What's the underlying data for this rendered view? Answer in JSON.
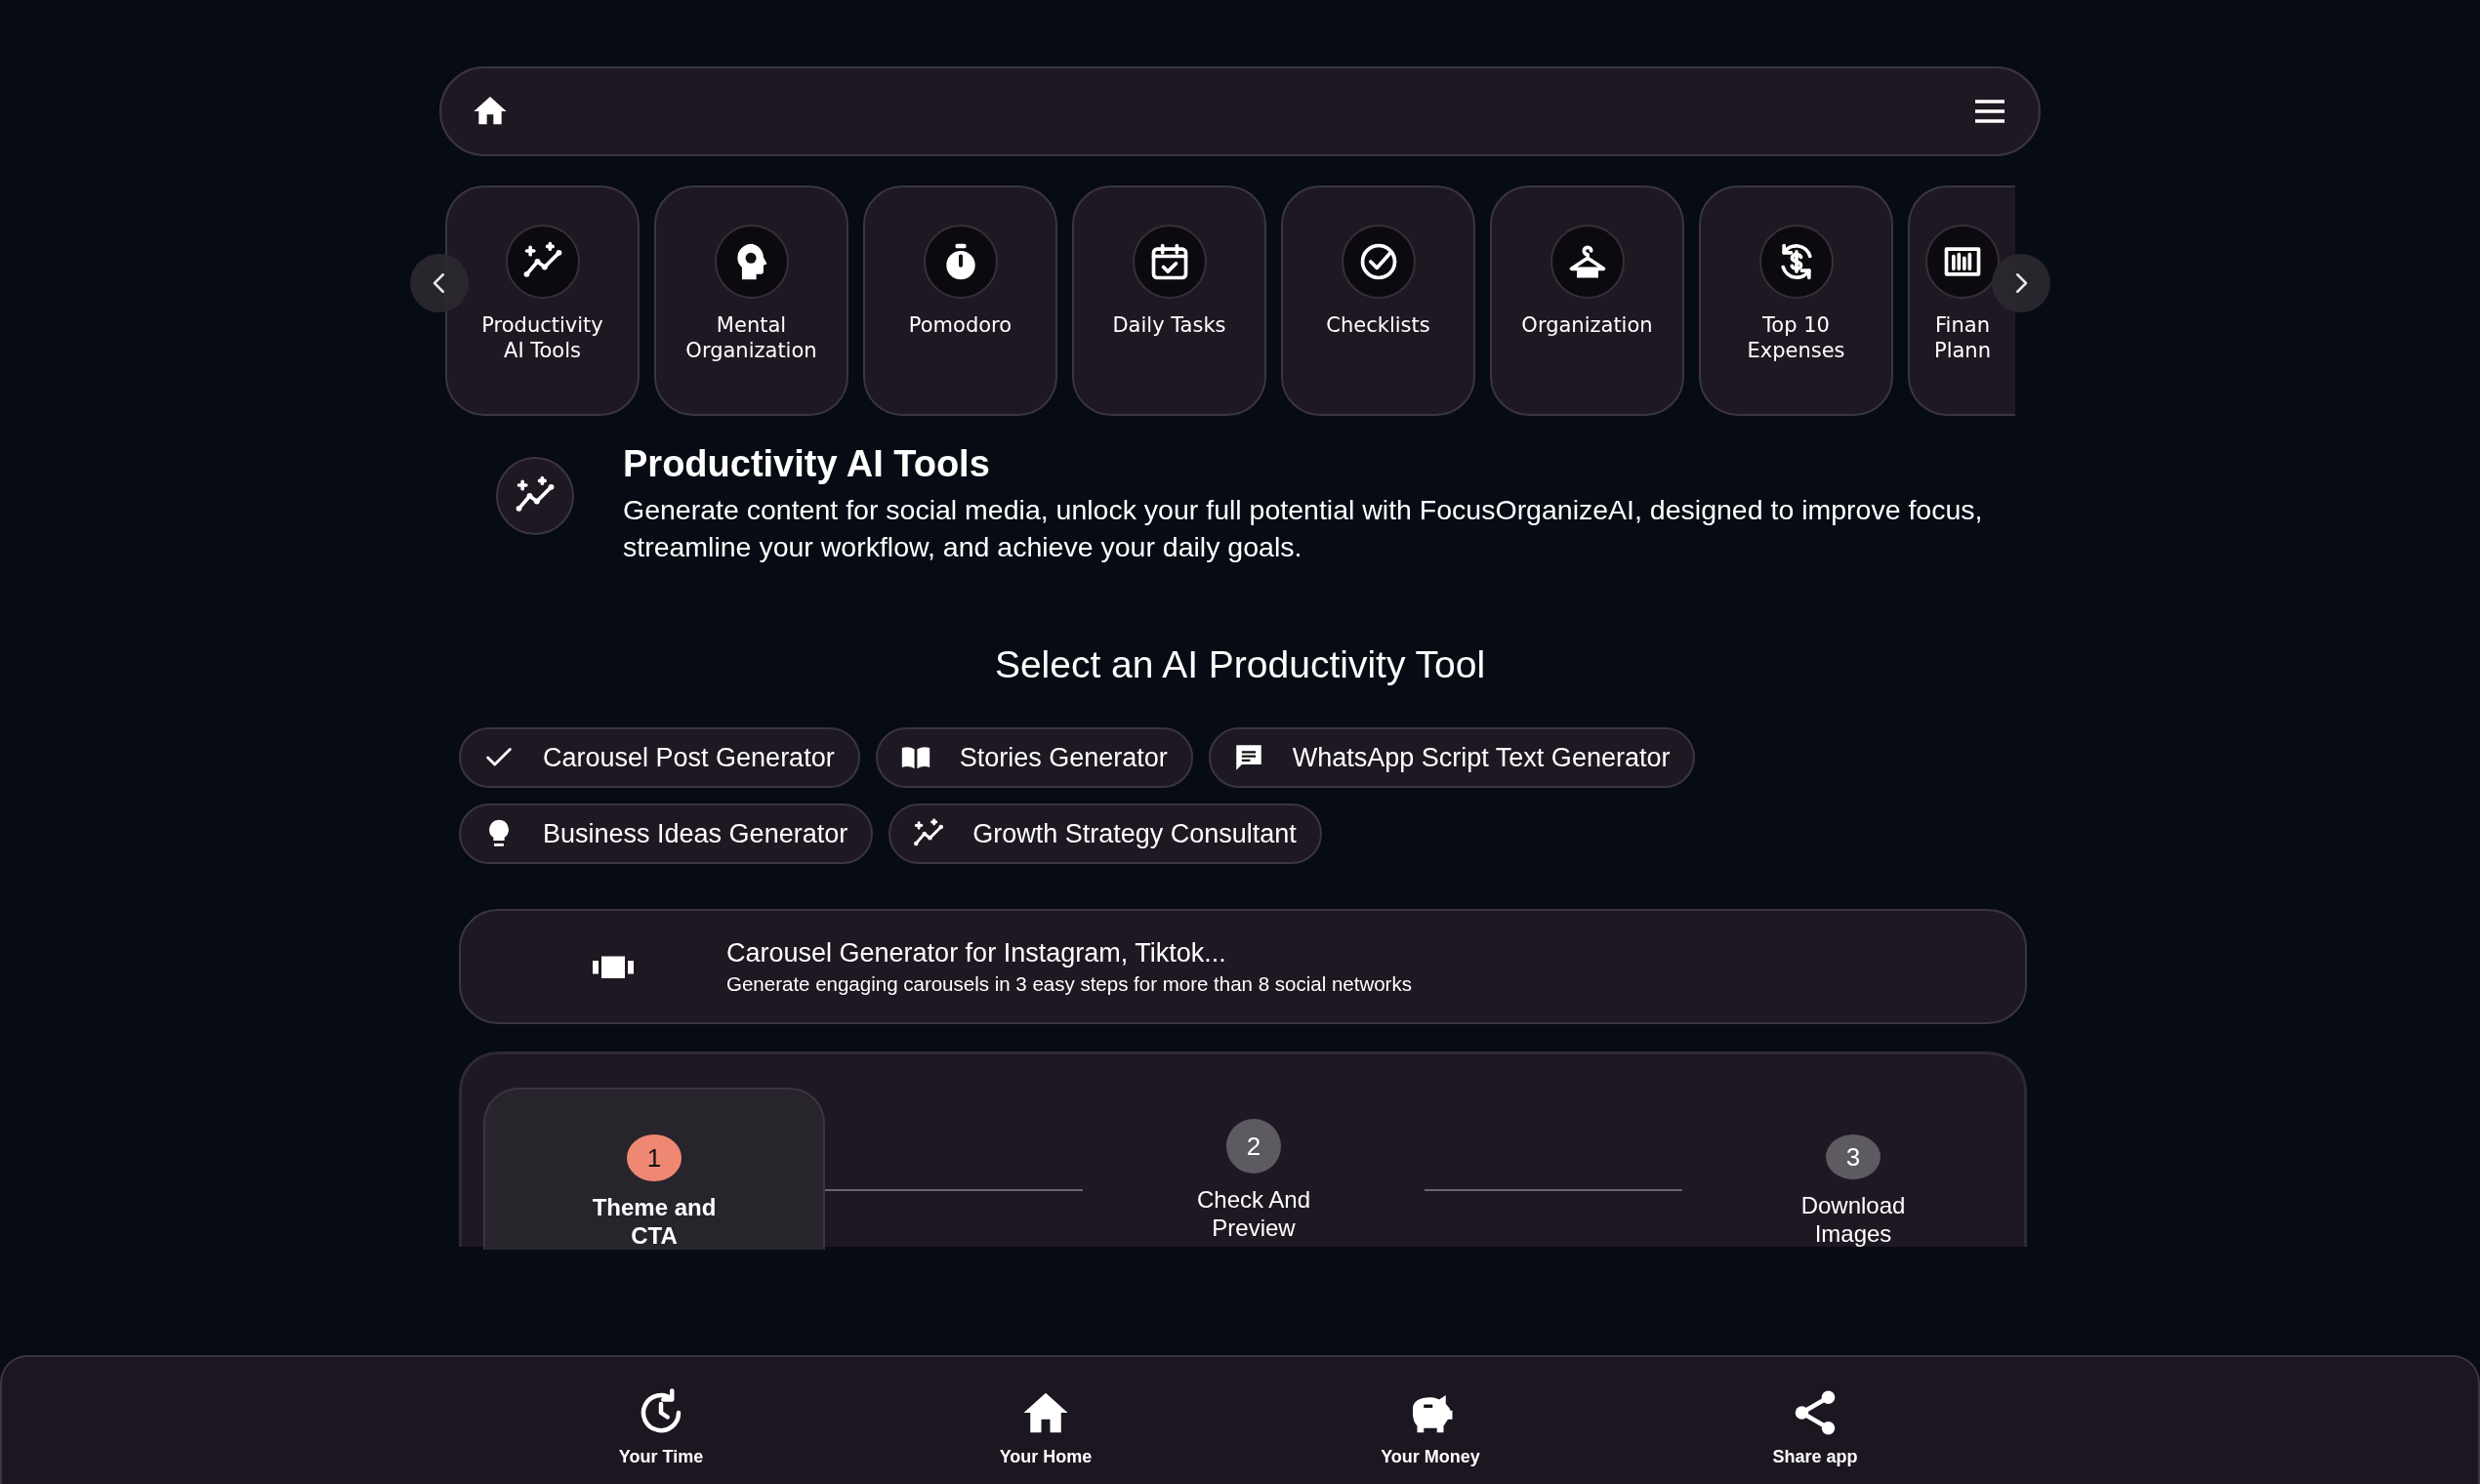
{
  "categories": [
    {
      "lines": [
        "Productivity",
        "AI Tools"
      ]
    },
    {
      "lines": [
        "Mental",
        "Organization"
      ]
    },
    {
      "lines": [
        "Pomodoro"
      ]
    },
    {
      "lines": [
        "Daily Tasks"
      ]
    },
    {
      "lines": [
        "Checklists"
      ]
    },
    {
      "lines": [
        "Organization"
      ]
    },
    {
      "lines": [
        "Top 10",
        "Expenses"
      ]
    },
    {
      "lines": [
        "Finan",
        "Plann"
      ]
    }
  ],
  "intro": {
    "title": "Productivity AI Tools",
    "text": "Generate content for social media, unlock your full potential with FocusOrganizeAI, designed to improve focus, streamline your workflow, and achieve your daily goals."
  },
  "tools_heading": "Select an AI Productivity Tool",
  "tools": [
    [
      "Carousel Post Generator",
      "Stories Generator",
      "WhatsApp Script Text Generator"
    ],
    [
      "Business Ideas Generator",
      "Growth Strategy Consultant"
    ]
  ],
  "carousel": {
    "title": "Carousel Generator for Instagram, Tiktok...",
    "subtitle": "Generate engaging carousels in 3 easy steps for more than 8 social networks"
  },
  "steps": [
    {
      "number": "1",
      "label": "Theme and CTA",
      "selected": true
    },
    {
      "number": "2",
      "label": "Check And Preview",
      "selected": false
    },
    {
      "number": "3",
      "label": "Download Images",
      "selected": false
    }
  ],
  "bottom_nav": [
    {
      "label": "Your Time"
    },
    {
      "label": "Your Home"
    },
    {
      "label": "Your Money"
    },
    {
      "label": "Share app"
    }
  ]
}
